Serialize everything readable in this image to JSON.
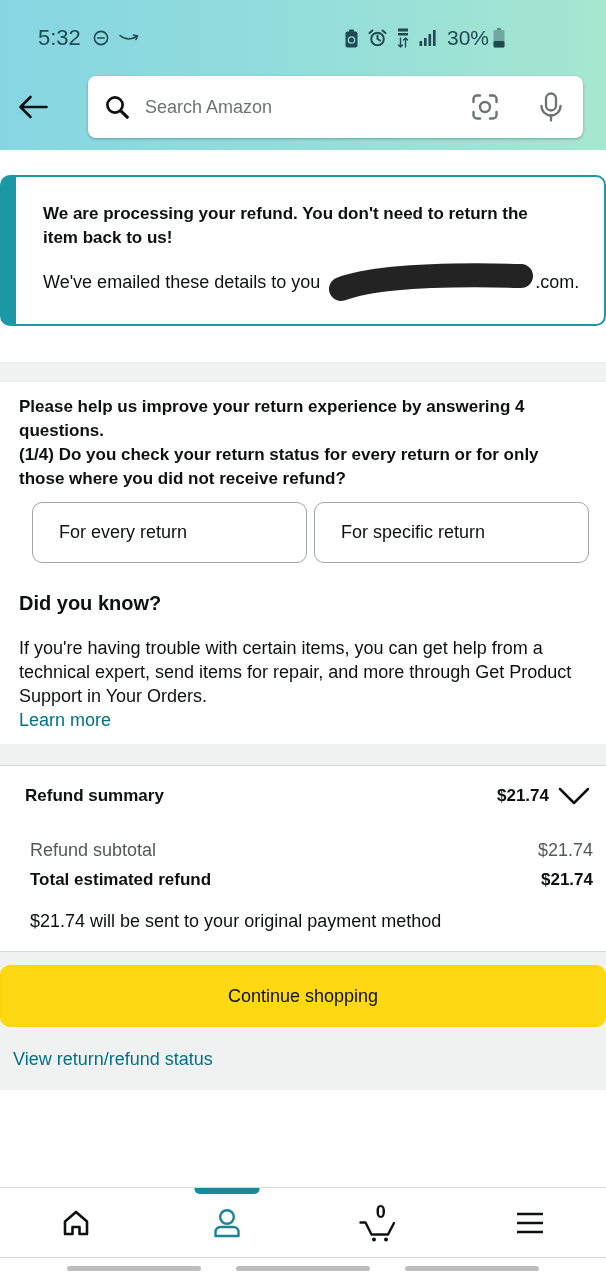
{
  "status_bar": {
    "time": "5:32",
    "battery": "30%"
  },
  "search": {
    "placeholder": "Search Amazon"
  },
  "notice": {
    "title": "We are processing your refund. You don't need to return the item back to us!",
    "email_text": "We've emailed these details to you",
    "email_redacted": true,
    "email_end": ".com."
  },
  "survey": {
    "intro": "Please help us improve your return experience by answering 4 questions.",
    "question": "(1/4) Do you check your return status for every return or for only those where you did not receive refund?",
    "options": [
      {
        "label": "For every return",
        "selected": false
      },
      {
        "label": "For specific return",
        "selected": false
      }
    ]
  },
  "did_you_know": {
    "title": "Did you know?",
    "text": "If you're having trouble with certain items, you can get help from a technical expert, send items for repair, and more through Get Product Support in Your Orders.",
    "link": "Learn more"
  },
  "refund_summary": {
    "title": "Refund summary",
    "amount": "$21.74",
    "expanded": true,
    "rows": [
      {
        "kind": "subtotal",
        "label": "Refund subtotal",
        "value": "$21.74"
      },
      {
        "kind": "total",
        "label": "Total estimated refund",
        "value": "$21.74"
      }
    ],
    "note": "$21.74 will be sent to your original payment method"
  },
  "continue_button": {
    "label": "Continue shopping"
  },
  "status_link": {
    "label": "View return/refund status"
  },
  "bottom_nav": [
    {
      "kind": "home",
      "selected": false
    },
    {
      "kind": "account",
      "selected": true
    },
    {
      "kind": "cart",
      "count": "0",
      "selected": false
    },
    {
      "kind": "menu",
      "selected": false
    }
  ]
}
